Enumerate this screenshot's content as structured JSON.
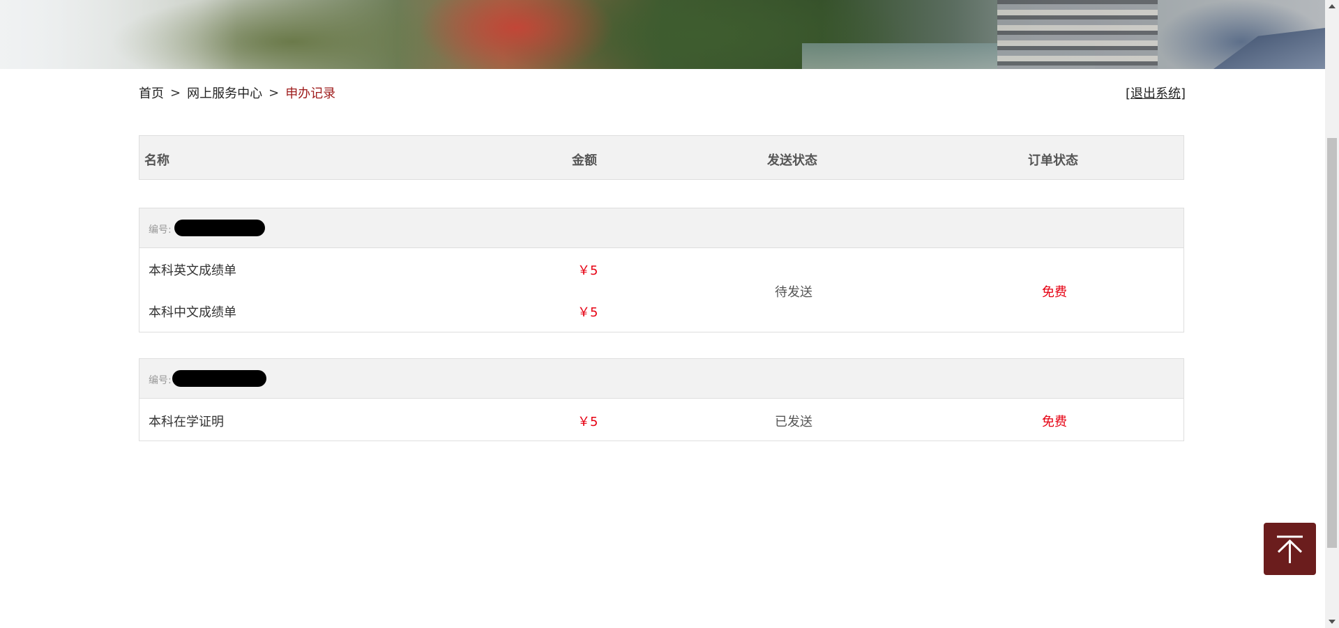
{
  "breadcrumb": {
    "home": "首页",
    "separator": ">",
    "service_center": "网上服务中心",
    "current": "申办记录"
  },
  "logout": {
    "open_bracket": "[",
    "label": "退出系统",
    "close_bracket": "]"
  },
  "table": {
    "headers": {
      "name": "名称",
      "amount": "金额",
      "send_status": "发送状态",
      "order_status": "订单状态"
    }
  },
  "orders": [
    {
      "id_label": "编号:",
      "id_value_redacted": true,
      "items": [
        {
          "name": "本科英文成绩单",
          "price": "￥5"
        },
        {
          "name": "本科中文成绩单",
          "price": "￥5"
        }
      ],
      "send_status": "待发送",
      "order_status": "免费"
    },
    {
      "id_label": "编号:",
      "id_value_redacted": true,
      "items": [
        {
          "name": "本科在学证明",
          "price": "￥5"
        }
      ],
      "send_status": "已发送",
      "order_status": "免费"
    }
  ],
  "colors": {
    "accent": "#9e1b1b",
    "price": "#e60012",
    "back_to_top": "#6b1d1d"
  },
  "icons": {
    "back_to_top": "arrow-up-to-top-icon"
  }
}
